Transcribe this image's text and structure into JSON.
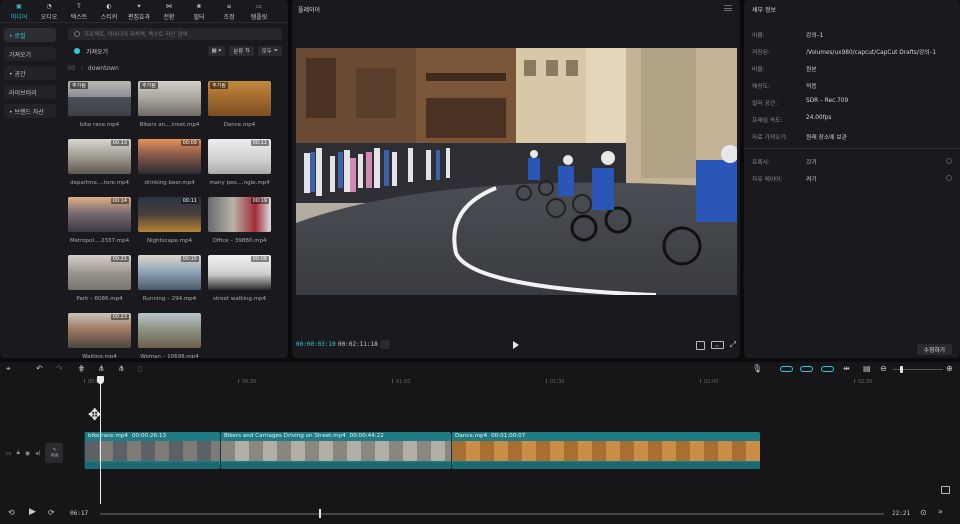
{
  "media_tabs": [
    {
      "label": "미디어",
      "icon": "media-icon",
      "active": true
    },
    {
      "label": "오디오",
      "icon": "audio-icon"
    },
    {
      "label": "텍스트",
      "icon": "text-icon"
    },
    {
      "label": "스티커",
      "icon": "sticker-icon"
    },
    {
      "label": "편집효과",
      "icon": "effects-icon"
    },
    {
      "label": "전환",
      "icon": "transition-icon"
    },
    {
      "label": "필터",
      "icon": "filter-icon"
    },
    {
      "label": "조정",
      "icon": "adjust-icon"
    },
    {
      "label": "템플릿",
      "icon": "template-icon"
    }
  ],
  "sidebar": {
    "items": [
      {
        "label": "• 로컬",
        "active": true
      },
      {
        "label": "가져오기"
      },
      {
        "label": "• 공간"
      },
      {
        "label": "라이브러리"
      },
      {
        "label": "• 브랜드 자산"
      }
    ]
  },
  "search": {
    "placeholder": "프로젝트, 아이디어 피처백, 텍스트 라인 검색"
  },
  "import_label": "가져오기",
  "sort_label": "분류",
  "all_label": "모두",
  "breadcrumb": {
    "root": "05",
    "current": "downtown"
  },
  "media": [
    {
      "name": "bike race.mp4",
      "added": "추가됨",
      "duration": "",
      "theme": "bike"
    },
    {
      "name": "Bikers an....treet.mp4",
      "added": "추가됨",
      "duration": "",
      "theme": "bikers"
    },
    {
      "name": "Dance.mp4",
      "added": "추가됨",
      "duration": "",
      "theme": "dance"
    },
    {
      "name": "departme....tore.mp4",
      "added": "",
      "duration": "00:13",
      "theme": "store"
    },
    {
      "name": "drinking beer.mp4",
      "added": "",
      "duration": "00:09",
      "theme": "beer"
    },
    {
      "name": "many peo....ngle.mp4",
      "added": "",
      "duration": "00:11",
      "theme": "people"
    },
    {
      "name": "Metropol....2337.mp4",
      "added": "",
      "duration": "00:14",
      "theme": "metro"
    },
    {
      "name": "Nightscape.mp4",
      "added": "",
      "duration": "00:11",
      "theme": "night"
    },
    {
      "name": "Office – 39880.mp4",
      "added": "",
      "duration": "00:19",
      "theme": "office"
    },
    {
      "name": "Park – 6086.mp4",
      "added": "",
      "duration": "00:21",
      "theme": "park"
    },
    {
      "name": "Running – 294.mp4",
      "added": "",
      "duration": "00:15",
      "theme": "running"
    },
    {
      "name": "street walking.mp4",
      "added": "",
      "duration": "00:08",
      "theme": "street"
    },
    {
      "name": "Waiting.mp4",
      "added": "",
      "duration": "00:23",
      "theme": "waiting"
    },
    {
      "name": "Woman – 10698.mp4",
      "added": "",
      "duration": "",
      "theme": "woman"
    }
  ],
  "player": {
    "title": "플레이어",
    "current_time": "00:00:03:10",
    "total_time": "00:02:11:18"
  },
  "details": {
    "title": "세부 정보",
    "rows": [
      {
        "key": "이름:",
        "value": "강의–1"
      },
      {
        "key": "저장된:",
        "value": "/Volumes/ux980/capcut/CapCut Drafts/강의–1"
      },
      {
        "key": "비율:",
        "value": "원본"
      },
      {
        "key": "해상도:",
        "value": "적응"
      },
      {
        "key": "컬러 공간:",
        "value": "SDR – Rec.709"
      },
      {
        "key": "프레임 속도:",
        "value": "24.00fps"
      },
      {
        "key": "자료 가져오기:",
        "value": "원래 장소에 보관"
      }
    ],
    "rows2": [
      {
        "key": "프록시:",
        "value": "끄기"
      },
      {
        "key": "자유 레이어:",
        "value": "켜기"
      }
    ],
    "modify_label": "수정하기"
  },
  "timeline": {
    "ruler": [
      {
        "label": "00:00",
        "t": 0
      },
      {
        "label": "00:30",
        "t": 0.5
      },
      {
        "label": "01:00",
        "t": 1
      },
      {
        "label": "01:30",
        "t": 1.5
      },
      {
        "label": "02:00",
        "t": 2
      },
      {
        "label": "02:30",
        "t": 2.5
      }
    ],
    "cover_label": "커버",
    "clips": [
      {
        "label": "bike race.mp4",
        "duration": "00:00:26:13",
        "theme": "bike"
      },
      {
        "label": "Bikers and Carriages Driving on Street.mp4",
        "duration": "00:00:44:22",
        "theme": "bikers"
      },
      {
        "label": "Dance.mp4",
        "duration": "00:01:00:07",
        "theme": "dance"
      }
    ],
    "position_time": "06:17",
    "total_time": "22:21"
  },
  "colors": {
    "accent": "#2ec9db",
    "clip": "#1f7c85",
    "panel": "#1a1a1e"
  }
}
